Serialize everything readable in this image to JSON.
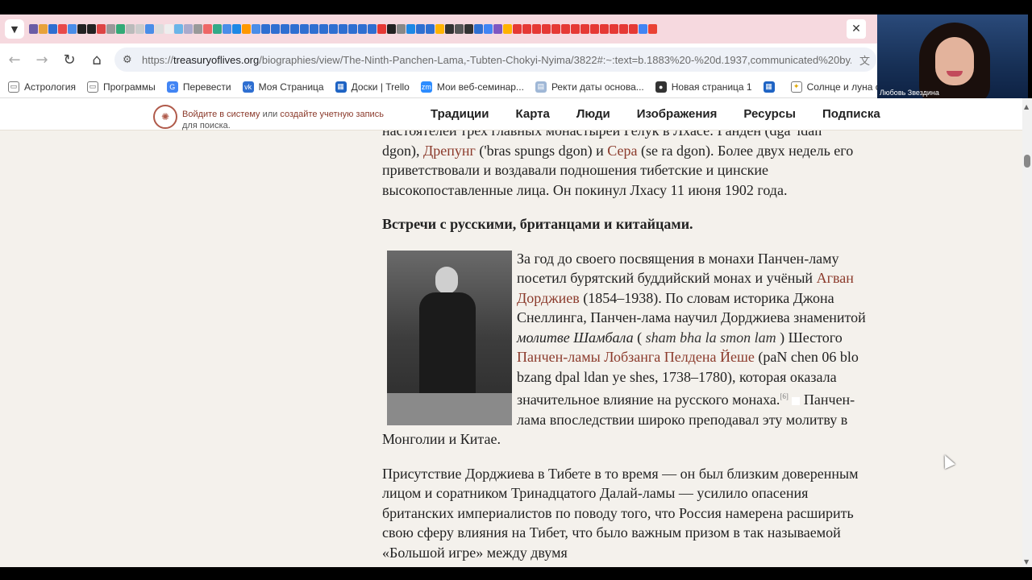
{
  "browser": {
    "url_host": "treasuryoflives.org",
    "url_prefix": "https://",
    "url_rest": "/biographies/view/The-Ninth-Panchen-Lama,-Tubten-Chokyi-Nyima/3822#:~:text=b.1883%20-%20d.1937,communicated%20by...",
    "bookmarks": [
      {
        "label": "Астрология",
        "icon": "folder-icon"
      },
      {
        "label": "Программы",
        "icon": "folder-icon"
      },
      {
        "label": "Перевести",
        "icon": "translate-icon"
      },
      {
        "label": "Моя Страница",
        "icon": "vk-icon"
      },
      {
        "label": "Доски | Trello",
        "icon": "trello-icon"
      },
      {
        "label": "Мои веб-семинар...",
        "icon": "zoom-icon"
      },
      {
        "label": "Ректи даты основа...",
        "icon": "page-icon"
      },
      {
        "label": "Новая страница 1",
        "icon": "globe-icon"
      },
      {
        "label": "",
        "icon": "trello-icon"
      },
      {
        "label": "Солнце и луна сего...",
        "icon": "sun-icon"
      }
    ],
    "tab_favicon_colors": [
      "#6b5ca5",
      "#e8a23a",
      "#2f6fd1",
      "#e84a4a",
      "#4a8de8",
      "#222",
      "#222",
      "#d44",
      "#999",
      "#3a7",
      "#bbb",
      "#ccc",
      "#4a8de8",
      "#ddd",
      "#eee",
      "#6bb5e8",
      "#aac",
      "#999",
      "#e66",
      "#3a8",
      "#4a8de8",
      "#1e88e5",
      "#ff9800",
      "#4a8de8",
      "#2f6fd1",
      "#2f6fd1",
      "#2f6fd1",
      "#2f6fd1",
      "#2f6fd1",
      "#2f6fd1",
      "#2f6fd1",
      "#2f6fd1",
      "#2f6fd1",
      "#2f6fd1",
      "#2f6fd1",
      "#2f6fd1",
      "#e53935",
      "#222",
      "#888",
      "#1e88e5",
      "#2f6fd1",
      "#2f6fd1",
      "#ffb300",
      "#333",
      "#555",
      "#333",
      "#2f6fd1",
      "#4285f4",
      "#7e57c2",
      "#ffb300",
      "#e53935",
      "#e53935",
      "#e53935",
      "#e53935",
      "#e53935",
      "#e53935",
      "#e53935",
      "#e53935",
      "#e53935",
      "#e53935",
      "#e53935",
      "#e53935",
      "#e53935",
      "#4285f4",
      "#ea4335"
    ]
  },
  "webcam": {
    "name": "Любовь Звездина"
  },
  "site": {
    "login_link": "Войдите в систему",
    "login_or": " или ",
    "signup_link": "создайте учетную запись",
    "login_tail": "для поиска.",
    "nav": [
      "Традиции",
      "Карта",
      "Люди",
      "Изображения",
      "Ресурсы",
      "Подписка"
    ]
  },
  "article": {
    "p1_cut": "настоятелей трех главных монастырей Гелук в Лхасе: Ганден (dga' ldan",
    "p1_a": "dgon), ",
    "p1_link1": "Дрепунг",
    "p1_b": " ('bras spungs dgon) и ",
    "p1_link2": "Сера",
    "p1_c": " (se ra dgon). Более двух недель его приветствовали и воздавали подношения тибетские и цинские высокопоставленные лица. Он покинул Лхасу 11 июня 1902 года.",
    "heading": "Встречи с русскими, британцами и китайцами.",
    "p2_a": "За год до своего посвящения в монахи Панчен-ламу посетил бурятский буддийский монах и учёный ",
    "p2_link1": "Агван Дорджиев",
    "p2_b": " (1854–1938). По словам историка Джона Снеллинга, Панчен-лама научил Дорджиева знаменитой ",
    "p2_em": "молитве Шамбала",
    "p2_c": " ( ",
    "p2_tib": "sham bha la smon lam",
    "p2_d": " ) Шестого ",
    "p2_link2": "Панчен-ламы Лобзанга Пелдена Йеше",
    "p2_e": " (paN chen 06 blo bzang dpal ldan ye shes, 1738–1780), которая оказала значительное влияние на русского монаха.",
    "p2_sup": "[6]",
    "p2_f": " Панчен-лама впоследствии широко преподавал эту молитву в Монголии и Китае.",
    "p3": "Присутствие Дорджиева в Тибете в то время — он был близким доверенным лицом и соратником Тринадцатого Далай-ламы — усилило опасения британских империалистов по поводу того, что Россия намерена расширить свою сферу влияния на Тибет, что было важным призом в так называемой «Большой игре» между двумя"
  }
}
